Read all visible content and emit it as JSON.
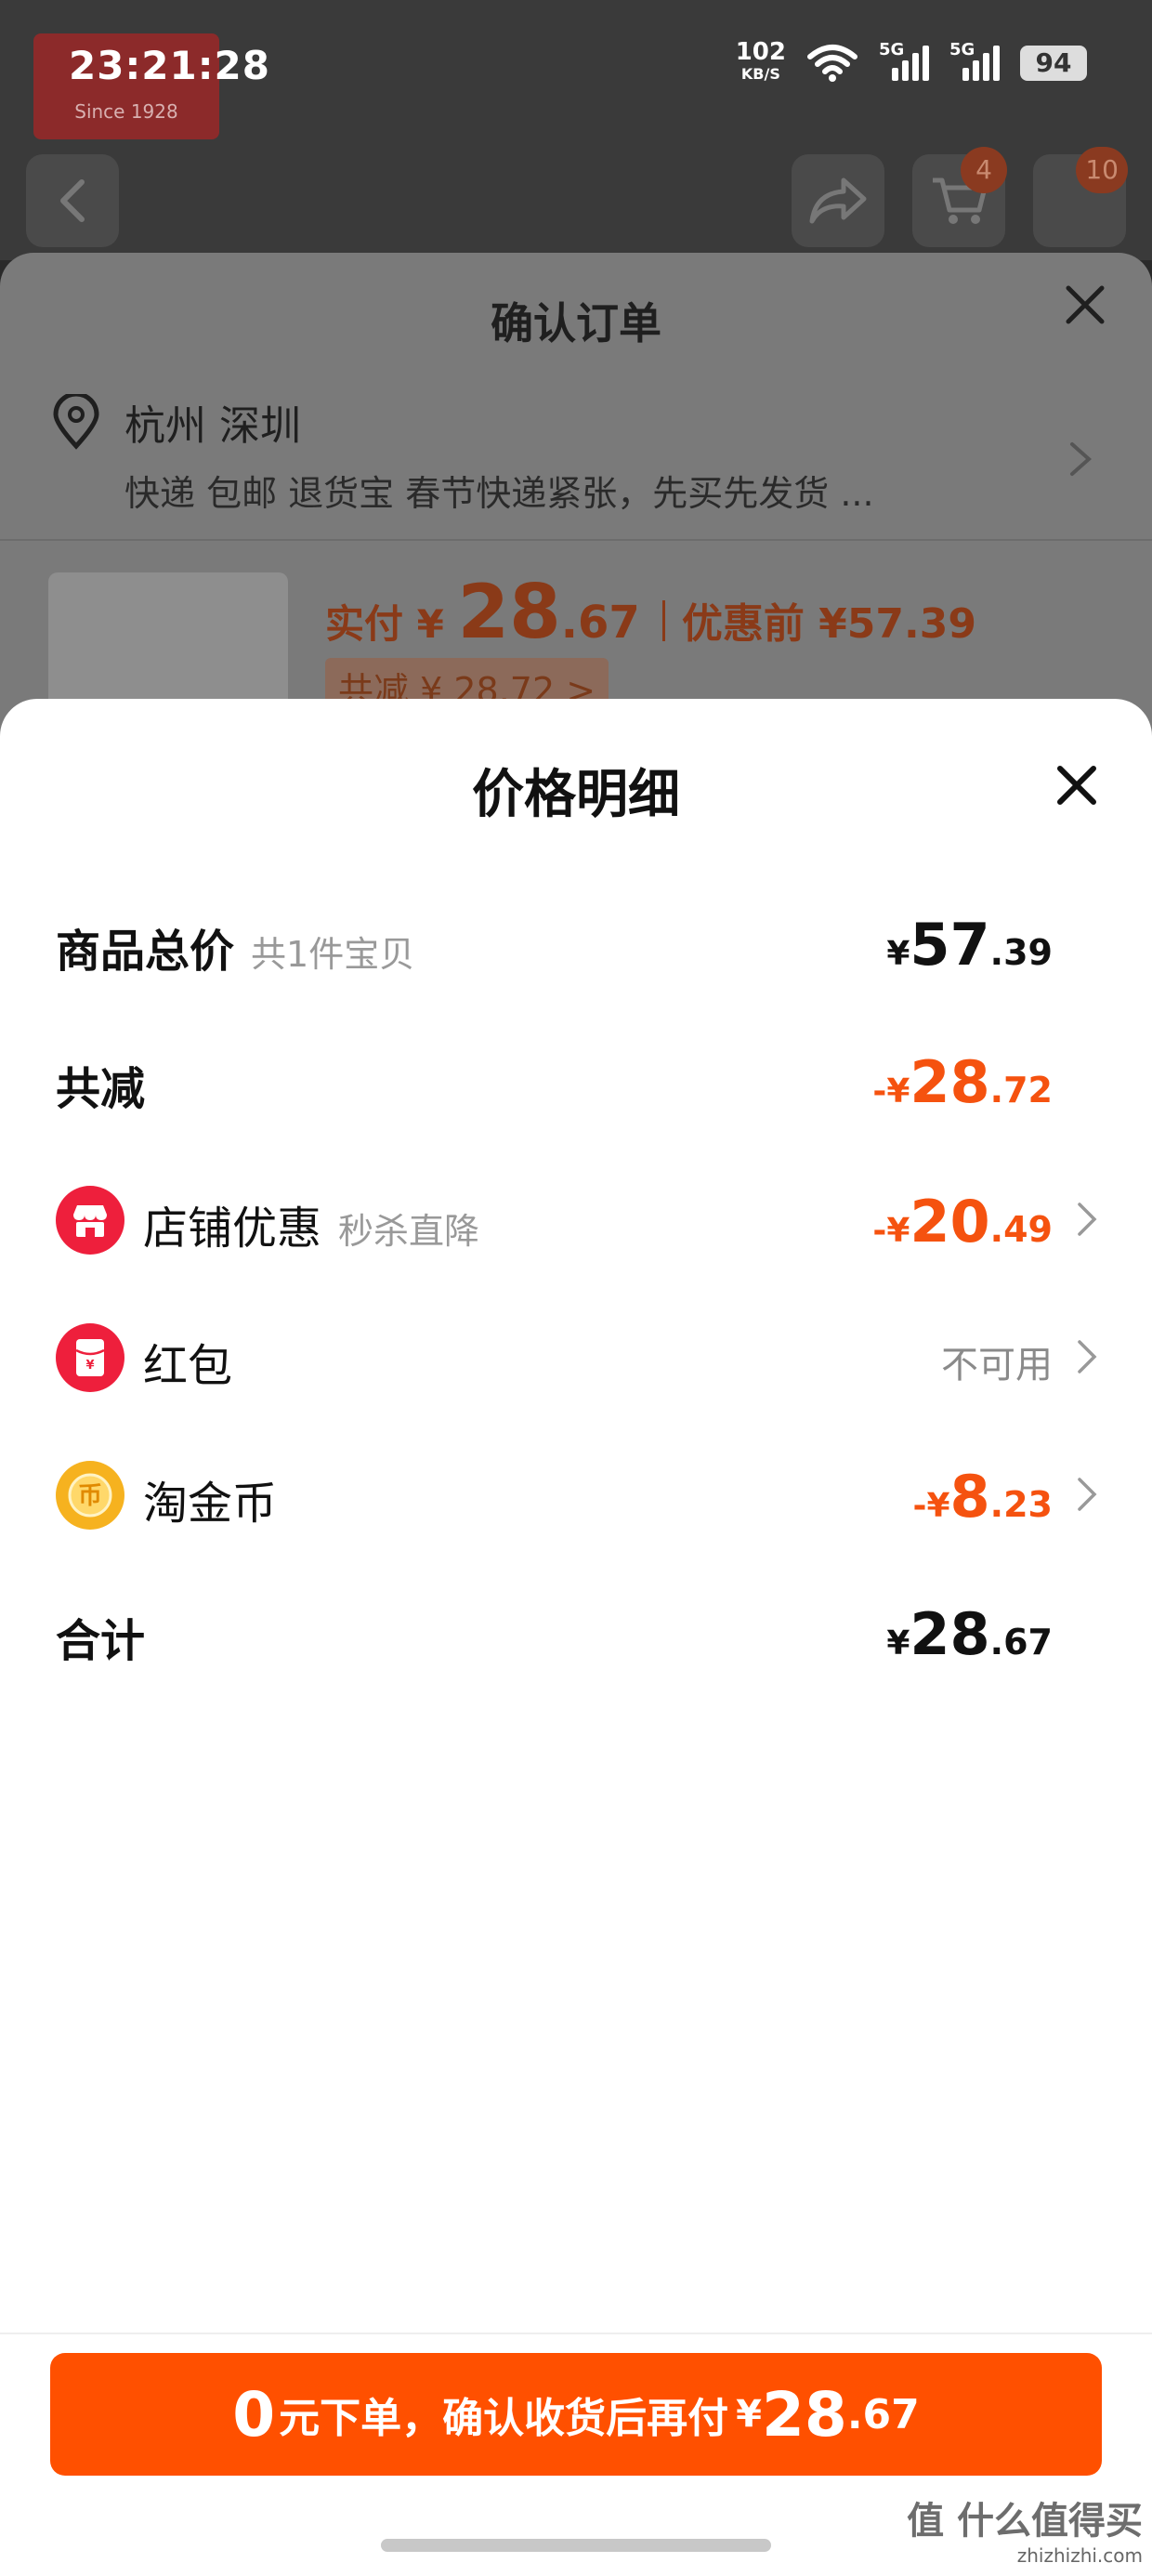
{
  "status_bar": {
    "time": "23:21:28",
    "net_speed": "102",
    "net_unit": "KB/S",
    "signal_label_1": "5G",
    "signal_label_2": "5G",
    "battery": "94"
  },
  "background": {
    "cart_badge": "4",
    "more_badge": "10",
    "order_sheet": {
      "title": "确认订单",
      "city": "杭州 深圳",
      "shipping": "快递 包邮 退货宝 春节快递紧张，先买先发货 ...",
      "pay_label": "实付 ¥ ",
      "pay_int": "28",
      "pay_dec": ".67",
      "before_label": "优惠前 ¥57.39",
      "save_label": "共减 ¥ 28.72 >"
    }
  },
  "sheet": {
    "title": "价格明细",
    "rows": [
      {
        "label": "商品总价",
        "hint": "共1件宝贝",
        "sign": "¥",
        "int": "57",
        "dec": ".39"
      },
      {
        "label": "共减",
        "sign": "-¥",
        "int": "28",
        "dec": ".72"
      },
      {
        "label": "店铺优惠",
        "hint": "秒杀直降",
        "sign": "-¥",
        "int": "20",
        "dec": ".49"
      },
      {
        "label": "红包",
        "status": "不可用"
      },
      {
        "label": "淘金币",
        "sign": "-¥",
        "int": "8",
        "dec": ".23"
      },
      {
        "label": "合计",
        "sign": "¥",
        "int": "28",
        "dec": ".67"
      }
    ]
  },
  "cta": {
    "zero": "0",
    "text": "元下单，确认收货后再付",
    "yen": "¥",
    "int": "28",
    "dec": ".67"
  },
  "watermark": {
    "line1": "值 什么值得买",
    "line2": "zhizhizhi.com"
  },
  "colors": {
    "accent_orange": "#ff5000",
    "discount_text": "#f5520f",
    "shop_icon_red": "#ee1f3c",
    "coin_gold": "#f6b21f"
  },
  "icons": [
    "location-pin-icon",
    "close-icon",
    "chevron-right-icon",
    "shop-icon",
    "red-envelope-icon",
    "gold-coin-icon",
    "back-icon",
    "share-icon",
    "cart-icon"
  ]
}
